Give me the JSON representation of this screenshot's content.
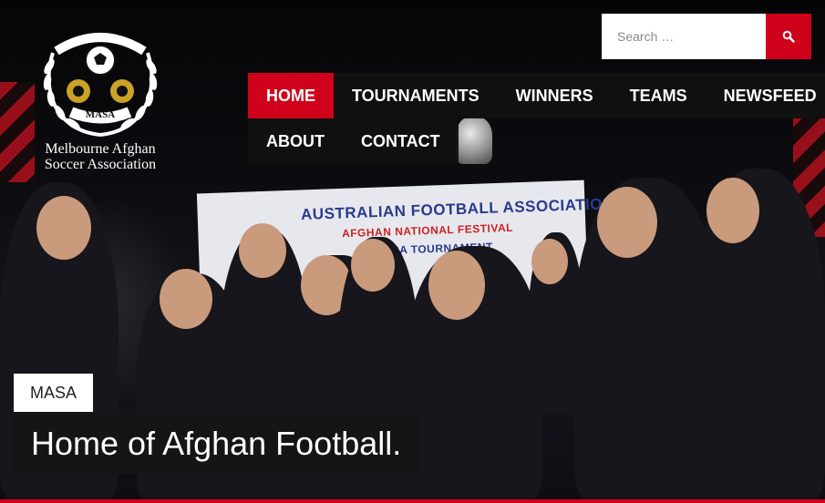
{
  "site": {
    "logo": {
      "badge_text": "MASA",
      "line1": "Melbourne Afghan",
      "line2": "Soccer Association"
    }
  },
  "search": {
    "placeholder": "Search …",
    "button_icon": "search-icon"
  },
  "nav": {
    "items": [
      {
        "label": "HOME",
        "active": true
      },
      {
        "label": "TOURNAMENTS",
        "active": false
      },
      {
        "label": "WINNERS",
        "active": false
      },
      {
        "label": "TEAMS",
        "active": false
      },
      {
        "label": "NEWSFEED",
        "active": false
      },
      {
        "label": "ABOUT",
        "active": false
      },
      {
        "label": "CONTACT",
        "active": false
      }
    ]
  },
  "hero": {
    "category": "MASA",
    "title": "Home of Afghan Football.",
    "banner_line1": "AUSTRALIAN FOOTBALL ASSOCIATION",
    "banner_line2": "AFGHAN NATIONAL FESTIVAL",
    "banner_line3": "MASA TOURNAMENT"
  },
  "colors": {
    "accent": "#d0021b",
    "nav_bg": "#111111",
    "text_light": "#ffffff"
  }
}
